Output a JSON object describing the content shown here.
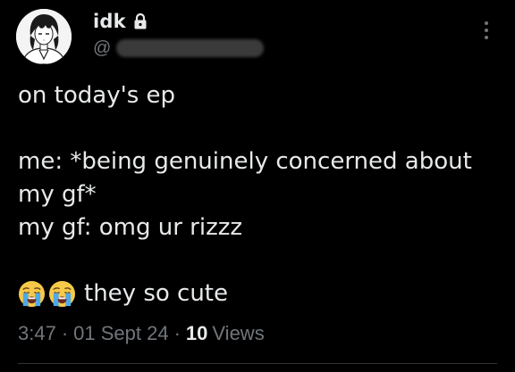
{
  "colors": {
    "background": "#000000",
    "text_primary": "#e7e9ea",
    "text_secondary": "#71767b",
    "divider": "#2f3336"
  },
  "author": {
    "display_name": "idk",
    "handle_prefix": "@",
    "protected_icon": "lock-icon",
    "avatar_icon": "avatar-anime-character"
  },
  "tweet": {
    "lines": [
      "on today's ep",
      "me: *being genuinely concerned about",
      "my gf*",
      "my gf: omg ur rizzz",
      "they so cute"
    ],
    "emojis": [
      "loudly-crying-face-emoji",
      "loudly-crying-face-emoji"
    ]
  },
  "meta": {
    "time": "3:47",
    "separator": "·",
    "date": "01 Sept 24",
    "views_count": "10",
    "views_label": "Views"
  },
  "menu": {
    "icon": "more-options-icon"
  }
}
